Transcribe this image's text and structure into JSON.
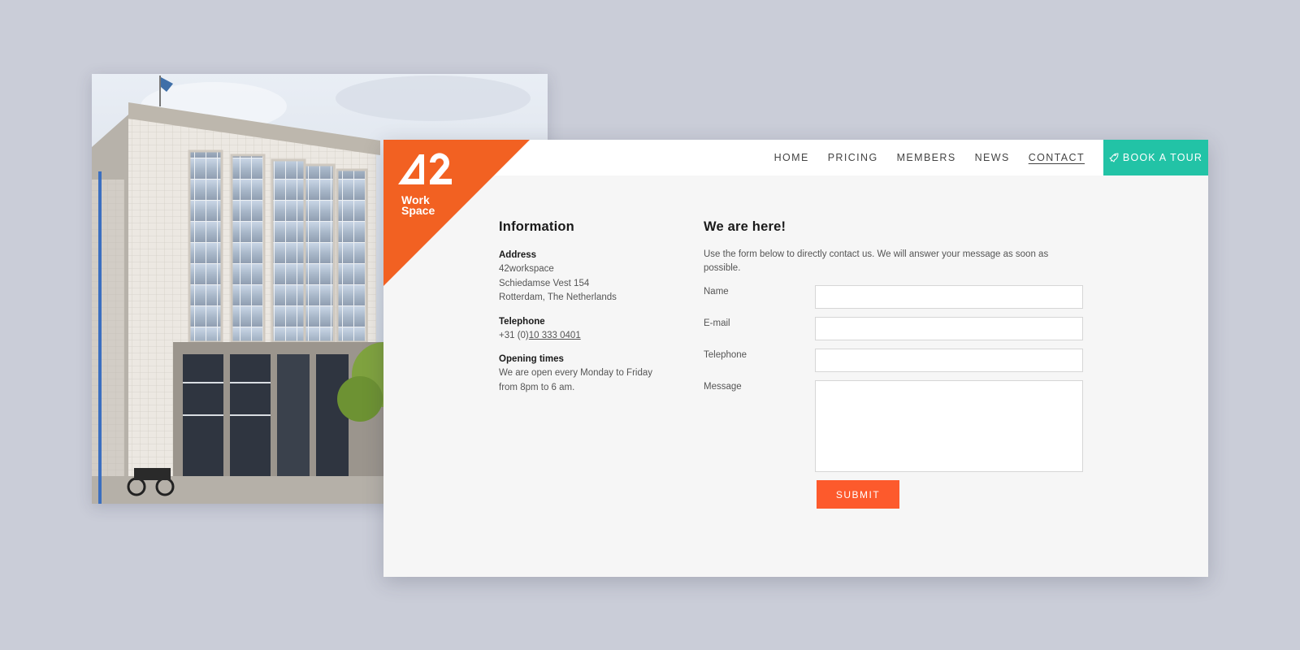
{
  "nav": {
    "items": [
      {
        "label": "HOME"
      },
      {
        "label": "PRICING"
      },
      {
        "label": "MEMBERS"
      },
      {
        "label": "NEWS"
      },
      {
        "label": "CONTACT",
        "active": true
      }
    ],
    "cta_label": "BOOK A TOUR",
    "cta_icon": "rocket-icon"
  },
  "logo": {
    "mark": "42",
    "line1": "Work",
    "line2": "Space"
  },
  "info": {
    "title": "Information",
    "address_label": "Address",
    "address_lines": [
      "42workspace",
      "Schiedamse Vest 154",
      "Rotterdam, The Netherlands"
    ],
    "telephone_label": "Telephone",
    "telephone_prefix": "+31 (0)",
    "telephone_number": "10 333 0401",
    "opening_label": "Opening times",
    "opening_lines": [
      "We are open every Monday to Friday",
      "from 8pm to 6 am."
    ]
  },
  "form": {
    "title": "We are here!",
    "intro": "Use the form below to directly contact us. We will answer your message as soon as possible.",
    "name_label": "Name",
    "email_label": "E-mail",
    "telephone_label": "Telephone",
    "message_label": "Message",
    "name_value": "",
    "email_value": "",
    "telephone_value": "",
    "message_value": "",
    "submit_label": "SUBMIT"
  },
  "colors": {
    "brand_orange": "#f26122",
    "submit_orange": "#fd5a2c",
    "cta_teal": "#22c3a6",
    "page_background": "#cacdd8",
    "site_background": "#f6f6f6"
  }
}
